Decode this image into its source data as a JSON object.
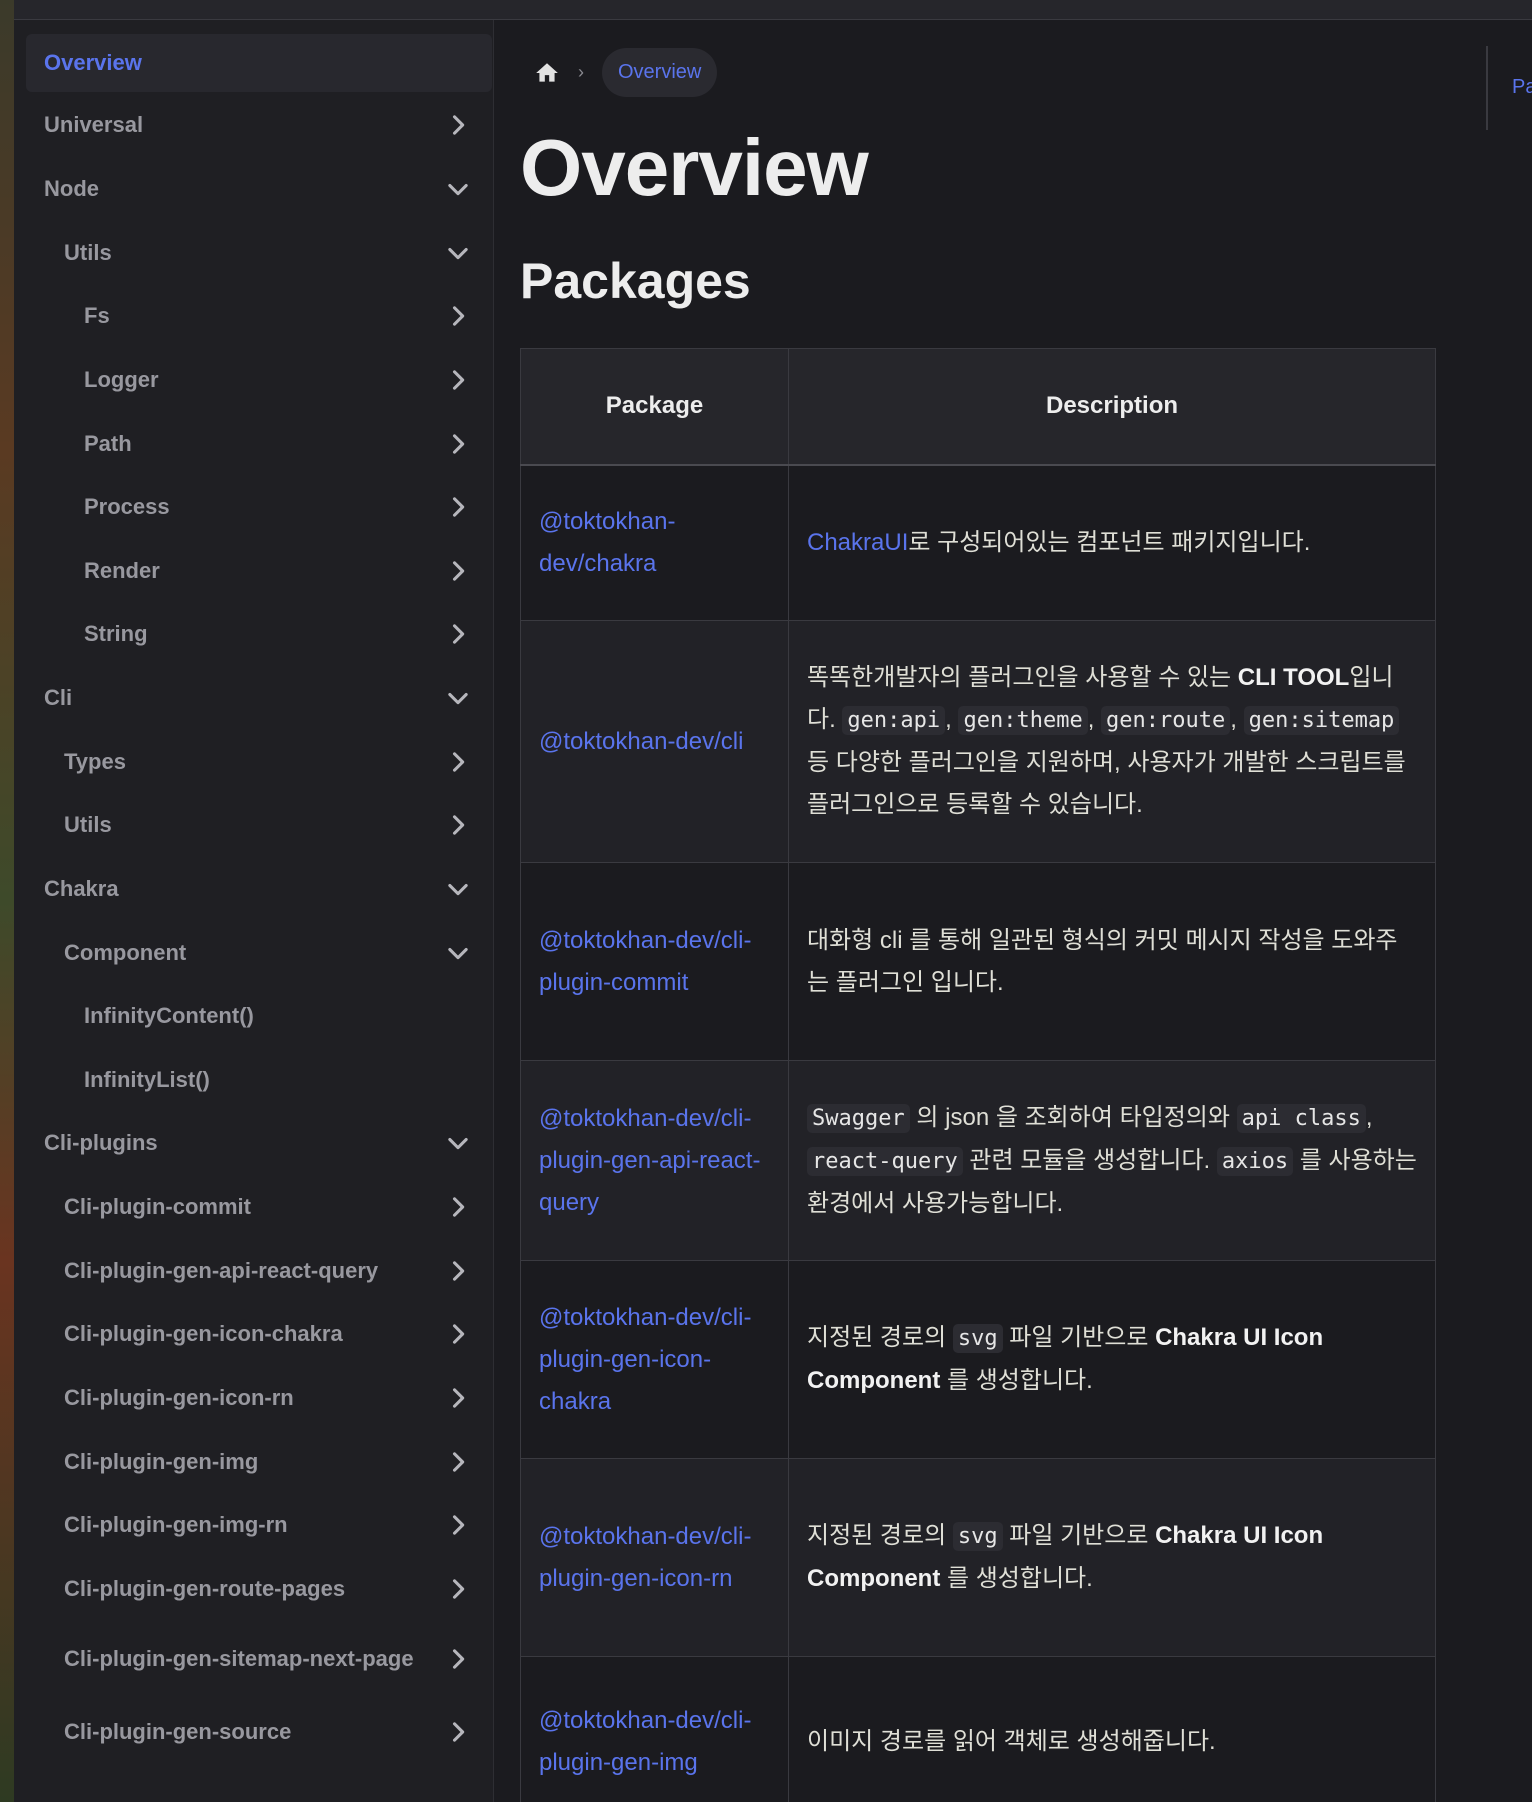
{
  "sidebar": {
    "items": [
      {
        "label": "Overview",
        "level": 0,
        "active": true,
        "chevron": "none"
      },
      {
        "label": "Universal",
        "level": 0,
        "chevron": "right"
      },
      {
        "label": "Node",
        "level": 0,
        "chevron": "down"
      },
      {
        "label": "Utils",
        "level": 1,
        "chevron": "down"
      },
      {
        "label": "Fs",
        "level": 2,
        "chevron": "right"
      },
      {
        "label": "Logger",
        "level": 2,
        "chevron": "right"
      },
      {
        "label": "Path",
        "level": 2,
        "chevron": "right"
      },
      {
        "label": "Process",
        "level": 2,
        "chevron": "right"
      },
      {
        "label": "Render",
        "level": 2,
        "chevron": "right"
      },
      {
        "label": "String",
        "level": 2,
        "chevron": "right"
      },
      {
        "label": "Cli",
        "level": 0,
        "chevron": "down"
      },
      {
        "label": "Types",
        "level": 1,
        "chevron": "right"
      },
      {
        "label": "Utils",
        "level": 1,
        "chevron": "right"
      },
      {
        "label": "Chakra",
        "level": 0,
        "chevron": "down"
      },
      {
        "label": "Component",
        "level": 1,
        "chevron": "down"
      },
      {
        "label": "InfinityContent()",
        "level": 2,
        "chevron": "none"
      },
      {
        "label": "InfinityList()",
        "level": 2,
        "chevron": "none"
      },
      {
        "label": "Cli-plugins",
        "level": 0,
        "chevron": "down"
      },
      {
        "label": "Cli-plugin-commit",
        "level": 1,
        "chevron": "right"
      },
      {
        "label": "Cli-plugin-gen-api-react-query",
        "level": 1,
        "chevron": "right"
      },
      {
        "label": "Cli-plugin-gen-icon-chakra",
        "level": 1,
        "chevron": "right"
      },
      {
        "label": "Cli-plugin-gen-icon-rn",
        "level": 1,
        "chevron": "right"
      },
      {
        "label": "Cli-plugin-gen-img",
        "level": 1,
        "chevron": "right"
      },
      {
        "label": "Cli-plugin-gen-img-rn",
        "level": 1,
        "chevron": "right"
      },
      {
        "label": "Cli-plugin-gen-route-pages",
        "level": 1,
        "chevron": "right"
      },
      {
        "label": "Cli-plugin-gen-sitemap-next-page",
        "level": 1,
        "chevron": "right"
      },
      {
        "label": "Cli-plugin-gen-source",
        "level": 1,
        "chevron": "right"
      }
    ]
  },
  "breadcrumb": {
    "current": "Overview"
  },
  "page": {
    "title": "Overview",
    "section": "Packages",
    "right_label": "Pa"
  },
  "table": {
    "headers": {
      "package": "Package",
      "description": "Description"
    },
    "rows": [
      {
        "pkg": "@toktokhan-dev/chakra",
        "segments": [
          {
            "t": "link",
            "v": "ChakraUI"
          },
          {
            "t": "text",
            "v": "로 구성되어있는 컴포넌트 패키지입니다."
          }
        ]
      },
      {
        "pkg": "@toktokhan-dev/cli",
        "segments": [
          {
            "t": "text",
            "v": "똑똑한개발자의 플러그인을 사용할 수 있는 "
          },
          {
            "t": "bold",
            "v": "CLI TOOL"
          },
          {
            "t": "text",
            "v": "입니다. "
          },
          {
            "t": "code",
            "v": "gen:api"
          },
          {
            "t": "text",
            "v": ", "
          },
          {
            "t": "code",
            "v": "gen:theme"
          },
          {
            "t": "text",
            "v": ", "
          },
          {
            "t": "code",
            "v": "gen:route"
          },
          {
            "t": "text",
            "v": ", "
          },
          {
            "t": "code",
            "v": "gen:sitemap"
          },
          {
            "t": "text",
            "v": " 등 다양한 플러그인을 지원하며, 사용자가 개발한 스크립트를 플러그인으로 등록할 수 있습니다."
          }
        ]
      },
      {
        "pkg": "@toktokhan-dev/cli-plugin-commit",
        "segments": [
          {
            "t": "text",
            "v": "대화형 cli 를 통해 일관된 형식의 커밋 메시지 작성을 도와주는 플러그인 입니다."
          }
        ]
      },
      {
        "pkg": "@toktokhan-dev/cli-plugin-gen-api-react-query",
        "segments": [
          {
            "t": "code",
            "v": "Swagger"
          },
          {
            "t": "text",
            "v": " 의 json 을 조회하여 타입정의와 "
          },
          {
            "t": "code",
            "v": "api class"
          },
          {
            "t": "text",
            "v": ", "
          },
          {
            "t": "code",
            "v": "react-query"
          },
          {
            "t": "text",
            "v": " 관련 모듈을 생성합니다. "
          },
          {
            "t": "code",
            "v": "axios"
          },
          {
            "t": "text",
            "v": " 를 사용하는 환경에서 사용가능합니다."
          }
        ]
      },
      {
        "pkg": "@toktokhan-dev/cli-plugin-gen-icon-chakra",
        "segments": [
          {
            "t": "text",
            "v": "지정된 경로의 "
          },
          {
            "t": "code",
            "v": "svg"
          },
          {
            "t": "text",
            "v": " 파일 기반으로 "
          },
          {
            "t": "bold",
            "v": "Chakra UI Icon Component"
          },
          {
            "t": "text",
            "v": " 를 생성합니다."
          }
        ]
      },
      {
        "pkg": "@toktokhan-dev/cli-plugin-gen-icon-rn",
        "segments": [
          {
            "t": "text",
            "v": "지정된 경로의 "
          },
          {
            "t": "code",
            "v": "svg"
          },
          {
            "t": "text",
            "v": " 파일 기반으로 "
          },
          {
            "t": "bold",
            "v": "Chakra UI Icon Component"
          },
          {
            "t": "text",
            "v": " 를 생성합니다."
          }
        ]
      },
      {
        "pkg": "@toktokhan-dev/cli-plugin-gen-img",
        "segments": [
          {
            "t": "text",
            "v": "이미지 경로를 읽어 객체로 생성해줍니다."
          }
        ]
      }
    ]
  },
  "colors": {
    "accent": "#5a74ec",
    "background": "#1b1b1f",
    "sidebar": "#1f1f23"
  }
}
